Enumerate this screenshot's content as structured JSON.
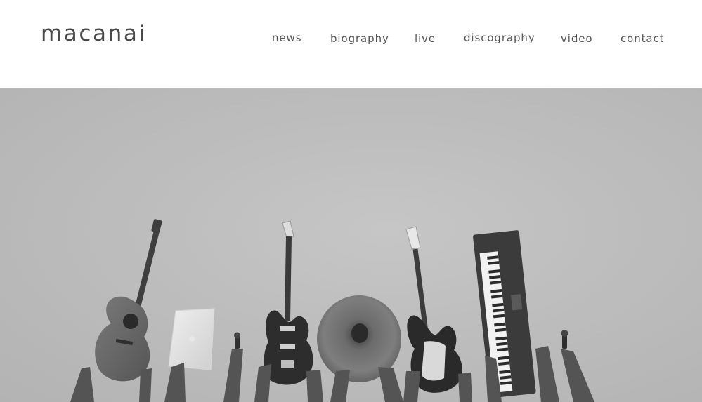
{
  "site": {
    "logo": "macanai"
  },
  "nav": {
    "items": [
      {
        "label": "news"
      },
      {
        "label": "biography"
      },
      {
        "label": "live"
      },
      {
        "label": "discography"
      },
      {
        "label": "video"
      },
      {
        "label": "contact"
      }
    ]
  },
  "hero": {
    "tone": "grayscale",
    "instruments": [
      "acoustic-guitar",
      "laptop",
      "microphone",
      "electric-guitar",
      "cymbal",
      "bass-guitar",
      "keyboard",
      "microphone"
    ]
  }
}
